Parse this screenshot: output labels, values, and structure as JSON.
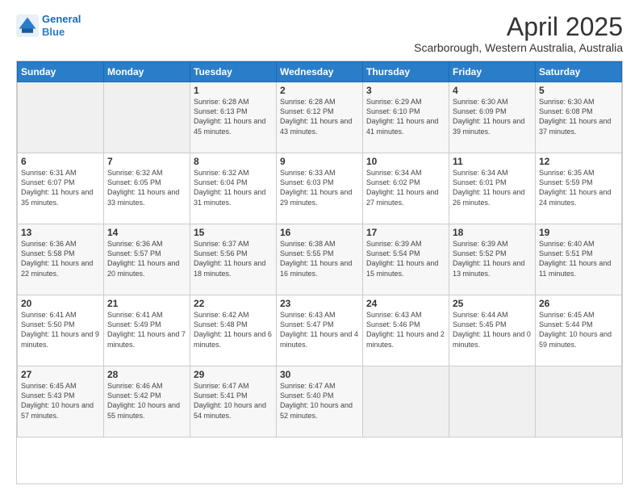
{
  "header": {
    "logo_line1": "General",
    "logo_line2": "Blue",
    "main_title": "April 2025",
    "subtitle": "Scarborough, Western Australia, Australia"
  },
  "days_of_week": [
    "Sunday",
    "Monday",
    "Tuesday",
    "Wednesday",
    "Thursday",
    "Friday",
    "Saturday"
  ],
  "weeks": [
    [
      {
        "day": "",
        "sunrise": "",
        "sunset": "",
        "daylight": ""
      },
      {
        "day": "",
        "sunrise": "",
        "sunset": "",
        "daylight": ""
      },
      {
        "day": "1",
        "sunrise": "Sunrise: 6:28 AM",
        "sunset": "Sunset: 6:13 PM",
        "daylight": "Daylight: 11 hours and 45 minutes."
      },
      {
        "day": "2",
        "sunrise": "Sunrise: 6:28 AM",
        "sunset": "Sunset: 6:12 PM",
        "daylight": "Daylight: 11 hours and 43 minutes."
      },
      {
        "day": "3",
        "sunrise": "Sunrise: 6:29 AM",
        "sunset": "Sunset: 6:10 PM",
        "daylight": "Daylight: 11 hours and 41 minutes."
      },
      {
        "day": "4",
        "sunrise": "Sunrise: 6:30 AM",
        "sunset": "Sunset: 6:09 PM",
        "daylight": "Daylight: 11 hours and 39 minutes."
      },
      {
        "day": "5",
        "sunrise": "Sunrise: 6:30 AM",
        "sunset": "Sunset: 6:08 PM",
        "daylight": "Daylight: 11 hours and 37 minutes."
      }
    ],
    [
      {
        "day": "6",
        "sunrise": "Sunrise: 6:31 AM",
        "sunset": "Sunset: 6:07 PM",
        "daylight": "Daylight: 11 hours and 35 minutes."
      },
      {
        "day": "7",
        "sunrise": "Sunrise: 6:32 AM",
        "sunset": "Sunset: 6:05 PM",
        "daylight": "Daylight: 11 hours and 33 minutes."
      },
      {
        "day": "8",
        "sunrise": "Sunrise: 6:32 AM",
        "sunset": "Sunset: 6:04 PM",
        "daylight": "Daylight: 11 hours and 31 minutes."
      },
      {
        "day": "9",
        "sunrise": "Sunrise: 6:33 AM",
        "sunset": "Sunset: 6:03 PM",
        "daylight": "Daylight: 11 hours and 29 minutes."
      },
      {
        "day": "10",
        "sunrise": "Sunrise: 6:34 AM",
        "sunset": "Sunset: 6:02 PM",
        "daylight": "Daylight: 11 hours and 27 minutes."
      },
      {
        "day": "11",
        "sunrise": "Sunrise: 6:34 AM",
        "sunset": "Sunset: 6:01 PM",
        "daylight": "Daylight: 11 hours and 26 minutes."
      },
      {
        "day": "12",
        "sunrise": "Sunrise: 6:35 AM",
        "sunset": "Sunset: 5:59 PM",
        "daylight": "Daylight: 11 hours and 24 minutes."
      }
    ],
    [
      {
        "day": "13",
        "sunrise": "Sunrise: 6:36 AM",
        "sunset": "Sunset: 5:58 PM",
        "daylight": "Daylight: 11 hours and 22 minutes."
      },
      {
        "day": "14",
        "sunrise": "Sunrise: 6:36 AM",
        "sunset": "Sunset: 5:57 PM",
        "daylight": "Daylight: 11 hours and 20 minutes."
      },
      {
        "day": "15",
        "sunrise": "Sunrise: 6:37 AM",
        "sunset": "Sunset: 5:56 PM",
        "daylight": "Daylight: 11 hours and 18 minutes."
      },
      {
        "day": "16",
        "sunrise": "Sunrise: 6:38 AM",
        "sunset": "Sunset: 5:55 PM",
        "daylight": "Daylight: 11 hours and 16 minutes."
      },
      {
        "day": "17",
        "sunrise": "Sunrise: 6:39 AM",
        "sunset": "Sunset: 5:54 PM",
        "daylight": "Daylight: 11 hours and 15 minutes."
      },
      {
        "day": "18",
        "sunrise": "Sunrise: 6:39 AM",
        "sunset": "Sunset: 5:52 PM",
        "daylight": "Daylight: 11 hours and 13 minutes."
      },
      {
        "day": "19",
        "sunrise": "Sunrise: 6:40 AM",
        "sunset": "Sunset: 5:51 PM",
        "daylight": "Daylight: 11 hours and 11 minutes."
      }
    ],
    [
      {
        "day": "20",
        "sunrise": "Sunrise: 6:41 AM",
        "sunset": "Sunset: 5:50 PM",
        "daylight": "Daylight: 11 hours and 9 minutes."
      },
      {
        "day": "21",
        "sunrise": "Sunrise: 6:41 AM",
        "sunset": "Sunset: 5:49 PM",
        "daylight": "Daylight: 11 hours and 7 minutes."
      },
      {
        "day": "22",
        "sunrise": "Sunrise: 6:42 AM",
        "sunset": "Sunset: 5:48 PM",
        "daylight": "Daylight: 11 hours and 6 minutes."
      },
      {
        "day": "23",
        "sunrise": "Sunrise: 6:43 AM",
        "sunset": "Sunset: 5:47 PM",
        "daylight": "Daylight: 11 hours and 4 minutes."
      },
      {
        "day": "24",
        "sunrise": "Sunrise: 6:43 AM",
        "sunset": "Sunset: 5:46 PM",
        "daylight": "Daylight: 11 hours and 2 minutes."
      },
      {
        "day": "25",
        "sunrise": "Sunrise: 6:44 AM",
        "sunset": "Sunset: 5:45 PM",
        "daylight": "Daylight: 11 hours and 0 minutes."
      },
      {
        "day": "26",
        "sunrise": "Sunrise: 6:45 AM",
        "sunset": "Sunset: 5:44 PM",
        "daylight": "Daylight: 10 hours and 59 minutes."
      }
    ],
    [
      {
        "day": "27",
        "sunrise": "Sunrise: 6:45 AM",
        "sunset": "Sunset: 5:43 PM",
        "daylight": "Daylight: 10 hours and 57 minutes."
      },
      {
        "day": "28",
        "sunrise": "Sunrise: 6:46 AM",
        "sunset": "Sunset: 5:42 PM",
        "daylight": "Daylight: 10 hours and 55 minutes."
      },
      {
        "day": "29",
        "sunrise": "Sunrise: 6:47 AM",
        "sunset": "Sunset: 5:41 PM",
        "daylight": "Daylight: 10 hours and 54 minutes."
      },
      {
        "day": "30",
        "sunrise": "Sunrise: 6:47 AM",
        "sunset": "Sunset: 5:40 PM",
        "daylight": "Daylight: 10 hours and 52 minutes."
      },
      {
        "day": "",
        "sunrise": "",
        "sunset": "",
        "daylight": ""
      },
      {
        "day": "",
        "sunrise": "",
        "sunset": "",
        "daylight": ""
      },
      {
        "day": "",
        "sunrise": "",
        "sunset": "",
        "daylight": ""
      }
    ]
  ]
}
